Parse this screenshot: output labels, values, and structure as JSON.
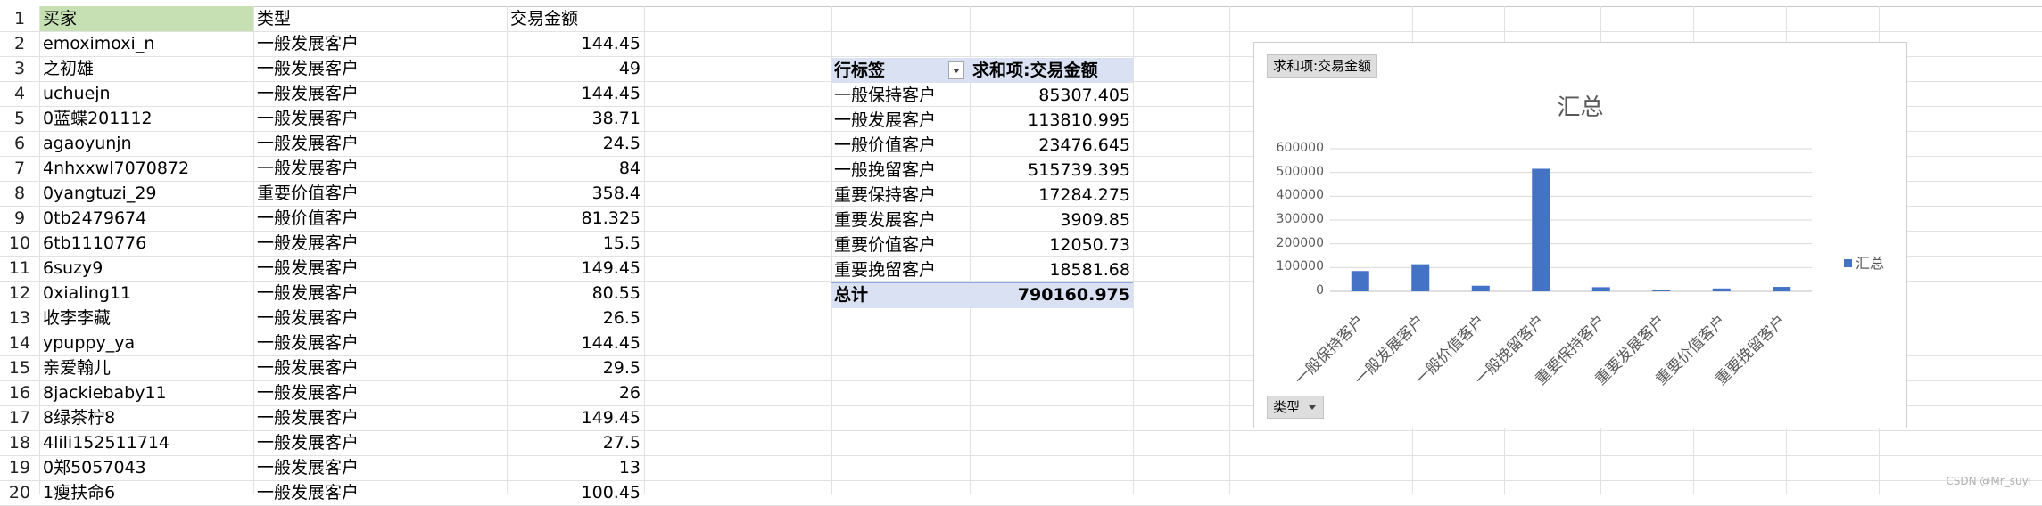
{
  "columns": {
    "a_header": "买家",
    "b_header": "类型",
    "c_header": "交易金额"
  },
  "rows": [
    {
      "num": "1"
    },
    {
      "num": "2",
      "buyer": "emoximoxi_n",
      "type": "一般发展客户",
      "amount": "144.45"
    },
    {
      "num": "3",
      "buyer": "之初雄",
      "type": "一般发展客户",
      "amount": "49"
    },
    {
      "num": "4",
      "buyer": "uchuejn",
      "type": "一般发展客户",
      "amount": "144.45"
    },
    {
      "num": "5",
      "buyer": "0蓝蝶201112",
      "type": "一般发展客户",
      "amount": "38.71"
    },
    {
      "num": "6",
      "buyer": "agaoyunjn",
      "type": "一般发展客户",
      "amount": "24.5"
    },
    {
      "num": "7",
      "buyer": "4nhxxwl7070872",
      "type": "一般发展客户",
      "amount": "84"
    },
    {
      "num": "8",
      "buyer": "0yangtuzi_29",
      "type": "重要价值客户",
      "amount": "358.4"
    },
    {
      "num": "9",
      "buyer": "0tb2479674",
      "type": "一般价值客户",
      "amount": "81.325"
    },
    {
      "num": "10",
      "buyer": "6tb1110776",
      "type": "一般发展客户",
      "amount": "15.5"
    },
    {
      "num": "11",
      "buyer": "6suzy9",
      "type": "一般发展客户",
      "amount": "149.45"
    },
    {
      "num": "12",
      "buyer": "0xialing11",
      "type": "一般发展客户",
      "amount": "80.55"
    },
    {
      "num": "13",
      "buyer": "收李李藏",
      "type": "一般发展客户",
      "amount": "26.5"
    },
    {
      "num": "14",
      "buyer": "ypuppy_ya",
      "type": "一般发展客户",
      "amount": "144.45"
    },
    {
      "num": "15",
      "buyer": "亲爱翰儿",
      "type": "一般发展客户",
      "amount": "29.5"
    },
    {
      "num": "16",
      "buyer": "8jackiebaby11",
      "type": "一般发展客户",
      "amount": "26"
    },
    {
      "num": "17",
      "buyer": "8绿茶柠8",
      "type": "一般发展客户",
      "amount": "149.45"
    },
    {
      "num": "18",
      "buyer": "4lili152511714",
      "type": "一般发展客户",
      "amount": "27.5"
    },
    {
      "num": "19",
      "buyer": "0郑5057043",
      "type": "一般发展客户",
      "amount": "13"
    },
    {
      "num": "20",
      "buyer": "1瘦扶命6",
      "type": "一般发展客户",
      "amount": "100.45"
    }
  ],
  "pivot": {
    "row_label": "行标签",
    "value_label": "求和项:交易金额",
    "items": [
      {
        "label": "一般保持客户",
        "value": "85307.405"
      },
      {
        "label": "一般发展客户",
        "value": "113810.995"
      },
      {
        "label": "一般价值客户",
        "value": "23476.645"
      },
      {
        "label": "一般挽留客户",
        "value": "515739.395"
      },
      {
        "label": "重要保持客户",
        "value": "17284.275"
      },
      {
        "label": "重要发展客户",
        "value": "3909.85"
      },
      {
        "label": "重要价值客户",
        "value": "12050.73"
      },
      {
        "label": "重要挽留客户",
        "value": "18581.68"
      }
    ],
    "total_label": "总计",
    "total_value": "790160.975"
  },
  "chart_ui": {
    "field_chip": "求和项:交易金额",
    "axis_chip": "类型",
    "bar_color": "#4472c4"
  },
  "chart_data": {
    "type": "bar",
    "title": "汇总",
    "categories": [
      "一般保持客户",
      "一般发展客户",
      "一般价值客户",
      "一般挽留客户",
      "重要保持客户",
      "重要发展客户",
      "重要价值客户",
      "重要挽留客户"
    ],
    "series": [
      {
        "name": "汇总",
        "values": [
          85307.405,
          113810.995,
          23476.645,
          515739.395,
          17284.275,
          3909.85,
          12050.73,
          18581.68
        ]
      }
    ],
    "yticks": [
      "0",
      "100000",
      "200000",
      "300000",
      "400000",
      "500000",
      "600000"
    ],
    "ylim": [
      0,
      600000
    ],
    "grid": true,
    "legend": "right"
  },
  "watermark": "CSDN @Mr_suyi"
}
